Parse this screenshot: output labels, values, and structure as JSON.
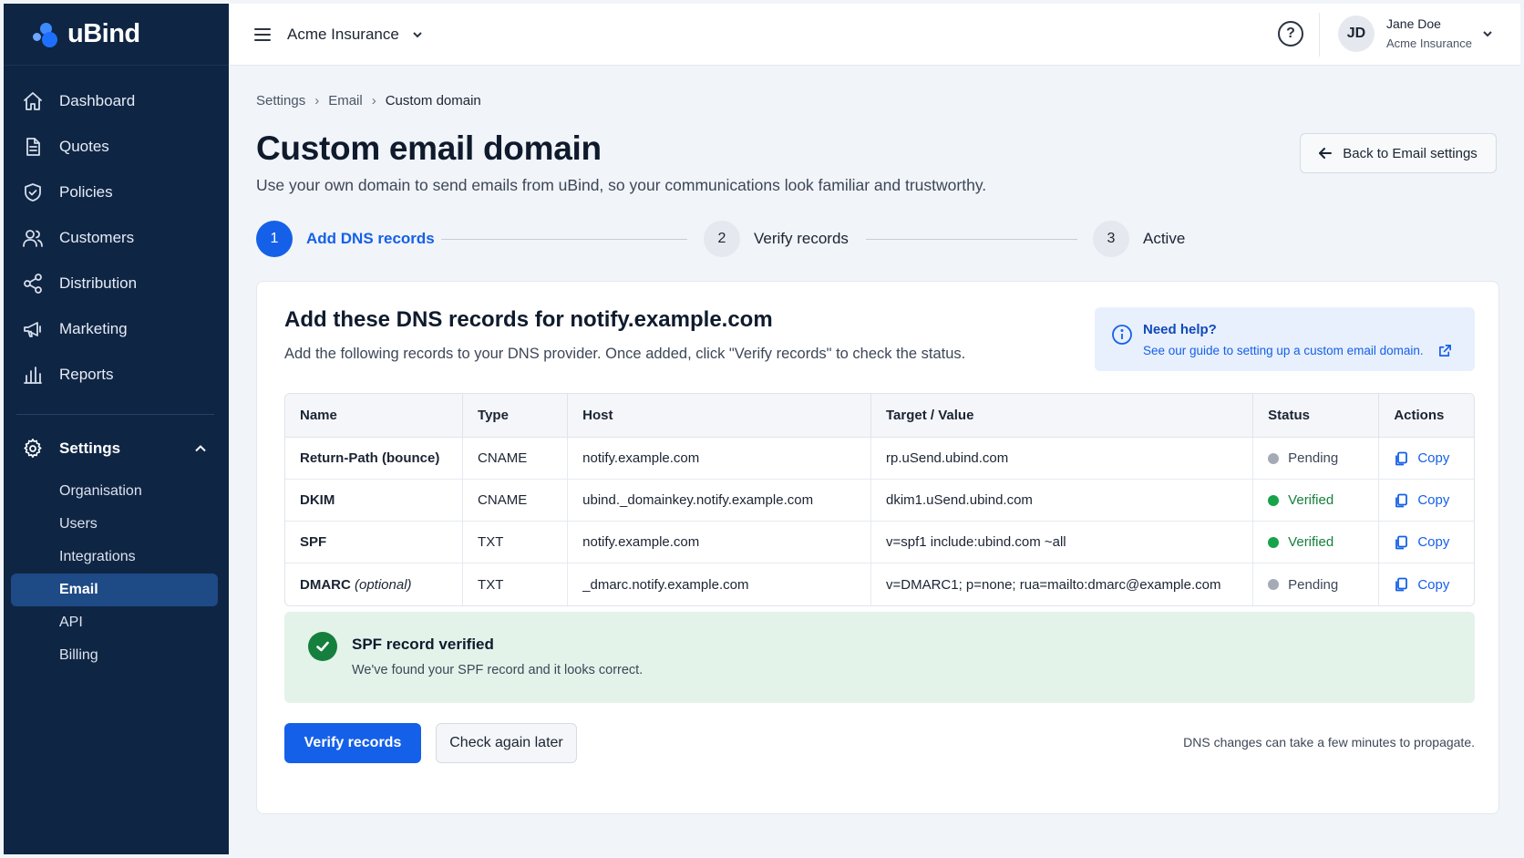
{
  "brand": {
    "name": "uBind"
  },
  "sidebar": {
    "items": [
      {
        "label": "Dashboard",
        "icon": "home-icon"
      },
      {
        "label": "Quotes",
        "icon": "document-icon"
      },
      {
        "label": "Policies",
        "icon": "shield-icon"
      },
      {
        "label": "Customers",
        "icon": "users-icon"
      },
      {
        "label": "Distribution",
        "icon": "share-icon"
      },
      {
        "label": "Marketing",
        "icon": "megaphone-icon"
      },
      {
        "label": "Reports",
        "icon": "bar-chart-icon"
      }
    ],
    "settings": {
      "label": "Settings",
      "expanded": true,
      "children": [
        "Organisation",
        "Users",
        "Integrations",
        "Email",
        "API",
        "Billing"
      ],
      "active": "Email"
    }
  },
  "topbar": {
    "org_name": "Acme Insurance",
    "help_glyph": "?",
    "user": {
      "initials": "JD",
      "name": "Jane Doe",
      "org": "Acme Insurance"
    }
  },
  "breadcrumb": [
    "Settings",
    "Email",
    "Custom domain"
  ],
  "page": {
    "title": "Custom email domain",
    "subtitle": "Use your own domain to send emails from uBind, so your communications look familiar and trustworthy.",
    "back_button": "Back to Email settings"
  },
  "stepper": [
    {
      "number": "1",
      "label": "Add DNS records",
      "state": "active"
    },
    {
      "number": "2",
      "label": "Verify records",
      "state": "idle"
    },
    {
      "number": "3",
      "label": "Active",
      "state": "idle"
    }
  ],
  "card": {
    "title": "Add these DNS records for notify.example.com",
    "subtitle": "Add the following records to your DNS provider. Once added, click \"Verify records\" to check the status.",
    "help": {
      "title": "Need help?",
      "link": "See our guide to setting up a custom email domain."
    },
    "table": {
      "columns": [
        "Name",
        "Type",
        "Host",
        "Target / Value",
        "Status",
        "Actions"
      ],
      "rows": [
        {
          "name": "Return-Path (bounce)",
          "name_suffix": "",
          "type": "CNAME",
          "host": "notify.example.com",
          "target": "rp.uSend.ubind.com",
          "status": "Pending",
          "action": "Copy"
        },
        {
          "name": "DKIM",
          "name_suffix": "",
          "type": "CNAME",
          "host": "ubind._domainkey.notify.example.com",
          "target": "dkim1.uSend.ubind.com",
          "status": "Verified",
          "action": "Copy"
        },
        {
          "name": "SPF",
          "name_suffix": "",
          "type": "TXT",
          "host": "notify.example.com",
          "target": "v=spf1 include:ubind.com ~all",
          "status": "Verified",
          "action": "Copy"
        },
        {
          "name": "DMARC",
          "name_suffix": "(optional)",
          "type": "TXT",
          "host": "_dmarc.notify.example.com",
          "target": "v=DMARC1; p=none; rua=mailto:dmarc@example.com",
          "status": "Pending",
          "action": "Copy"
        }
      ]
    },
    "success": {
      "title": "SPF record verified",
      "text": "We've found your SPF record and it looks correct."
    },
    "buttons": {
      "verify": "Verify records",
      "later": "Check again later"
    },
    "note": "DNS changes can take a few minutes to propagate."
  },
  "colors": {
    "sidebar_bg": "#0f2544",
    "accent": "#1560e8",
    "verified": "#16a34a",
    "pending": "#a4abb6",
    "success_bg": "#e4f3ea"
  }
}
